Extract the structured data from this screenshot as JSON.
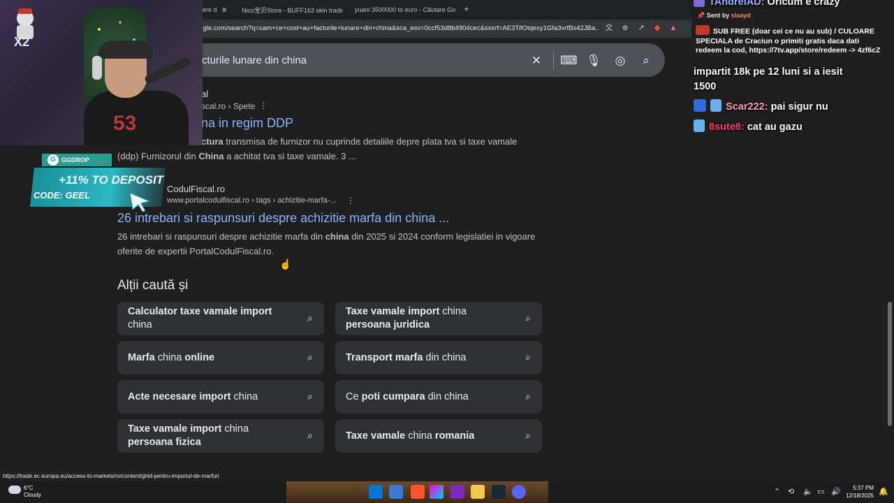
{
  "browser": {
    "tabs": [
      {
        "label": "ere d",
        "active": true
      },
      {
        "label": "Nico宝贝Store - BUFF163 skin tradin"
      },
      {
        "label": "yuani 3500000 to euro - Căutare Goo"
      }
    ],
    "new_tab": "+",
    "address": "oogle.com/search?q=cam+ce+cost+au+facturile+lunare+din+china&sca_esv=0ccf53d8b4904cec&sxsrf=AE3TifOtqexy1Gfa3vrfBs42JBa..."
  },
  "search": {
    "query": "cturile lunare din china"
  },
  "results": [
    {
      "site_name": "al",
      "url": "scal.ro › Spete",
      "title": "na in regim DDP",
      "snippet_line1_bold": "ctura",
      "snippet_line1_rest": " transmisa de furnizor nu cuprinde detaliile depre plata tva si taxe vamale",
      "snippet_line2_a": "(ddp) Furnizorul din ",
      "snippet_line2_bold": "China",
      "snippet_line2_b": " a achitat tva si taxe vamale. 3 ..."
    },
    {
      "site_name": "CodulFiscal.ro",
      "url": "www.portalcodulfiscal.ro › tags › achizitie-marfa-...",
      "title": "26 intrebari si raspunsuri despre achizitie marfa din china ...",
      "snippet_a": "26 intrebari si raspunsuri despre achizitie marfa din ",
      "snippet_bold": "china",
      "snippet_b": " din 2025 si 2024 conform legislatiei in vigoare",
      "snippet_line2": "oferite de expertii PortalCodulFiscal.ro."
    }
  ],
  "also_searched": {
    "heading": "Alții caută și",
    "chips": [
      {
        "b1": "Calculator taxe vamale import",
        "t1": "",
        "line2": "china"
      },
      {
        "b1": "Taxe vamale import",
        "t1": " china",
        "line2b": "persoana juridica"
      },
      {
        "b1": "Marfa",
        "t1": " china ",
        "b2": "online"
      },
      {
        "b1": "Transport marfa",
        "t1": " din china"
      },
      {
        "b1": "Acte necesare import",
        "t1": " china"
      },
      {
        "t0": "Ce ",
        "b1": "poti cumpara",
        "t1": " din china"
      },
      {
        "b1": "Taxe vamale import",
        "t1": " china",
        "line2b": "persoana fizica"
      },
      {
        "b1": "Taxe vamale",
        "t1": " china ",
        "b2": "romania"
      }
    ]
  },
  "status_url": "https://trade.ec.europa.eu/access-to-markets/ro/content/ghid-pentru-importul-de-marfuri",
  "overlay": {
    "logo_text": "X2",
    "shirt_text": "53",
    "sponsor_tag": "GGDROP",
    "sponsor_offer": "+11% TO DEPOSIT",
    "sponsor_code": "CODE: GEEL"
  },
  "chat": {
    "top_user": "TAndreiAD:",
    "top_msg": "Oricum e crazy",
    "pinned_by_label": "Sent by",
    "pinned_by_user": "slaayd",
    "pinned_msg": "SUB FREE (doar cei ce nu au sub) / CULOARE SPECIALA de Craciun o primiti gratis daca dati redeem la cod, https://7tv.app/store/redeem -> 4zf6cZ",
    "partial_msg_line1": "impartit 18k pe 12 luni si a iesit",
    "partial_msg_line2": "1500",
    "messages": [
      {
        "user": "Scar222:",
        "text": "pai sigur nu",
        "color": "#ff9eb5"
      },
      {
        "user": "8sute8:",
        "text": "cat au gazu",
        "color": "#ff3b6b"
      }
    ]
  },
  "taskbar": {
    "weather_temp": "6°C",
    "weather_desc": "Cloudy",
    "time": "5:37 PM",
    "date": "12/18/2025"
  },
  "colors": {
    "link": "#8ab4f8",
    "page_bg": "#1f1f1f",
    "chip_bg": "#303134"
  }
}
